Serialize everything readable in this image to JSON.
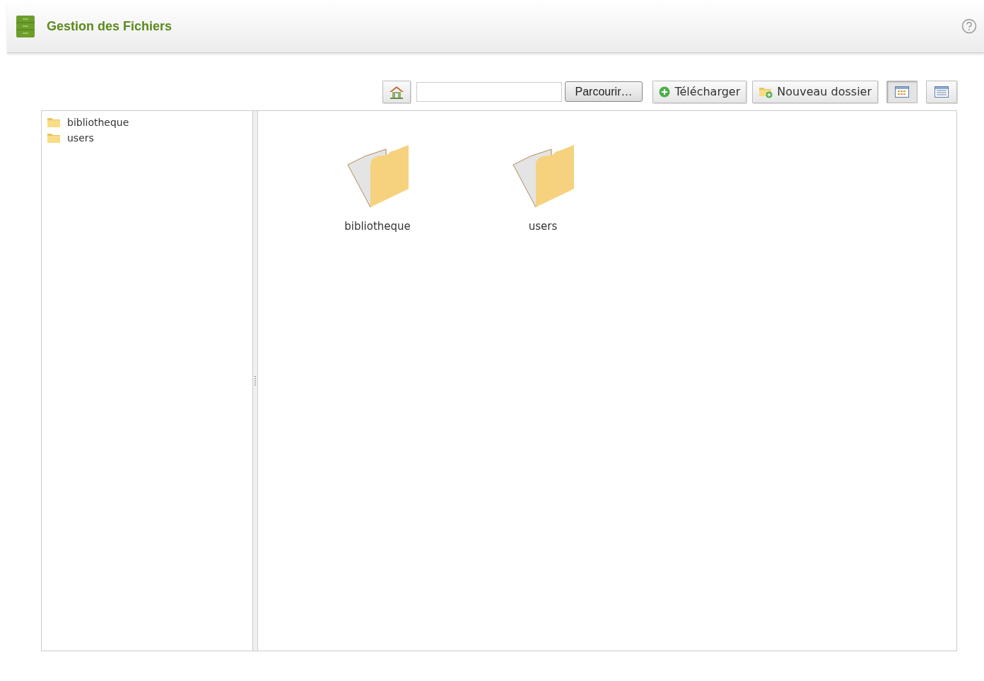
{
  "header": {
    "title": "Gestion des Fichiers"
  },
  "toolbar": {
    "upload_field": {
      "browse_label": "Parcourir…"
    },
    "upload_label": "Télécharger",
    "new_folder_label": "Nouveau dossier",
    "views": [
      {
        "kind": "icons",
        "selected": true
      },
      {
        "kind": "list",
        "selected": false
      }
    ]
  },
  "tree": [
    {
      "label": "bibliotheque"
    },
    {
      "label": "users"
    }
  ],
  "files": [
    {
      "label": "bibliotheque"
    },
    {
      "label": "users"
    }
  ]
}
